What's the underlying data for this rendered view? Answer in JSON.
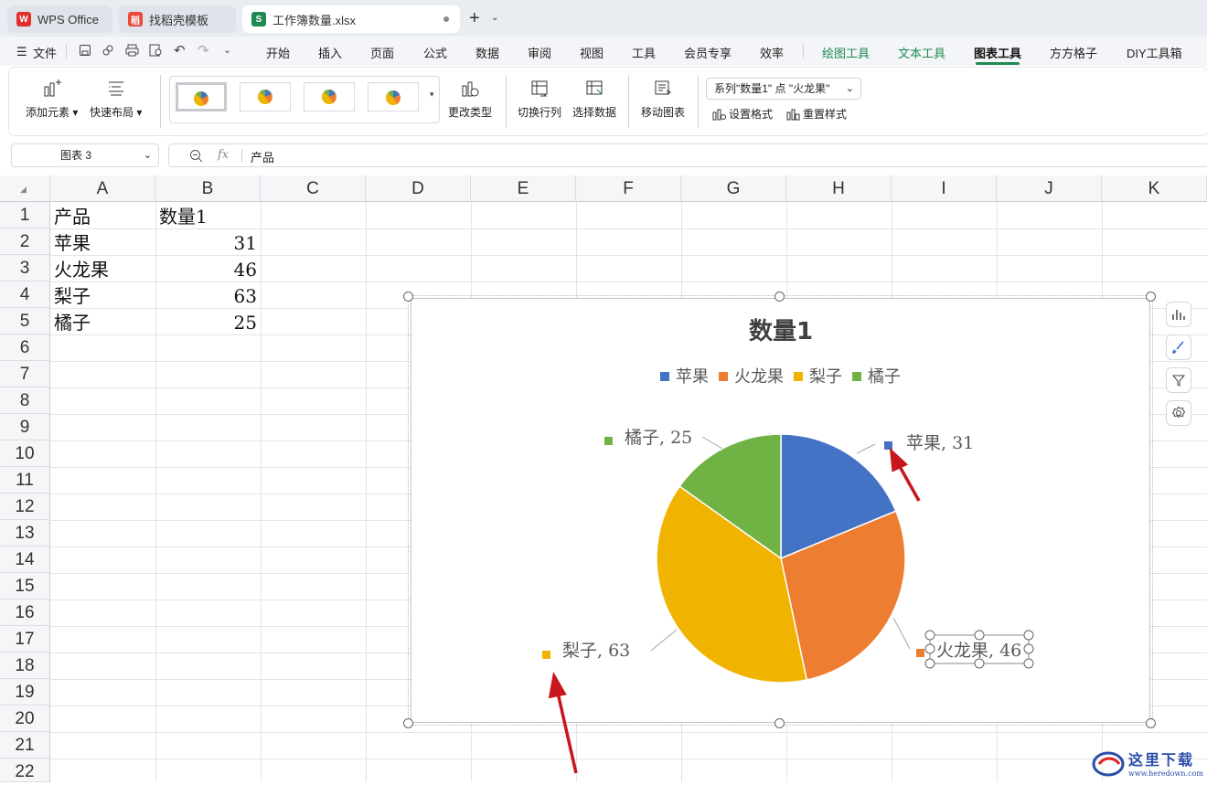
{
  "tabs": [
    {
      "label": "WPS Office"
    },
    {
      "label": "找稻壳模板"
    },
    {
      "label": "工作簿数量.xlsx"
    }
  ],
  "menu": {
    "file": "文件",
    "items": [
      "开始",
      "插入",
      "页面",
      "公式",
      "数据",
      "审阅",
      "视图",
      "工具",
      "会员专享",
      "效率"
    ],
    "context_items": [
      "绘图工具",
      "文本工具",
      "图表工具"
    ],
    "extra_items": [
      "方方格子",
      "DIY工具箱"
    ]
  },
  "ribbon": {
    "add_element": "添加元素",
    "quick_layout": "快速布局",
    "change_type": "更改类型",
    "switch_row_col": "切换行列",
    "select_data": "选择数据",
    "move_chart": "移动图表",
    "element_select": "系列\"数量1\" 点 \"火龙果\"",
    "set_format": "设置格式",
    "reset_style": "重置样式"
  },
  "formula_bar": {
    "name_box": "图表 3",
    "fx": "fx",
    "content": "产品"
  },
  "sheet": {
    "columns": [
      "A",
      "B",
      "C",
      "D",
      "E",
      "F",
      "G",
      "H",
      "I",
      "J",
      "K"
    ],
    "rows": [
      "1",
      "2",
      "3",
      "4",
      "5",
      "6",
      "7",
      "8",
      "9",
      "10",
      "11",
      "12",
      "13",
      "14",
      "15",
      "16",
      "17",
      "18",
      "19",
      "20",
      "21",
      "22"
    ],
    "cells": {
      "A1": "产品",
      "B1": "数量1",
      "A2": "苹果",
      "B2": "31",
      "A3": "火龙果",
      "B3": "46",
      "A4": "梨子",
      "B4": "63",
      "A5": "橘子",
      "B5": "25"
    }
  },
  "colors": {
    "apple": "#4472c4",
    "pitaya": "#ed7d31",
    "pear": "#f0b400",
    "orange": "#70b244",
    "accent": "#1f8a52"
  },
  "chart_data": {
    "type": "pie",
    "title": "数量1",
    "categories": [
      "苹果",
      "火龙果",
      "梨子",
      "橘子"
    ],
    "values": [
      31,
      46,
      63,
      25
    ],
    "data_labels": [
      "苹果, 31",
      "火龙果, 46",
      "梨子, 63",
      "橘子, 25"
    ],
    "legend_position": "top"
  },
  "watermark": "这里下载 www.heredown.com"
}
